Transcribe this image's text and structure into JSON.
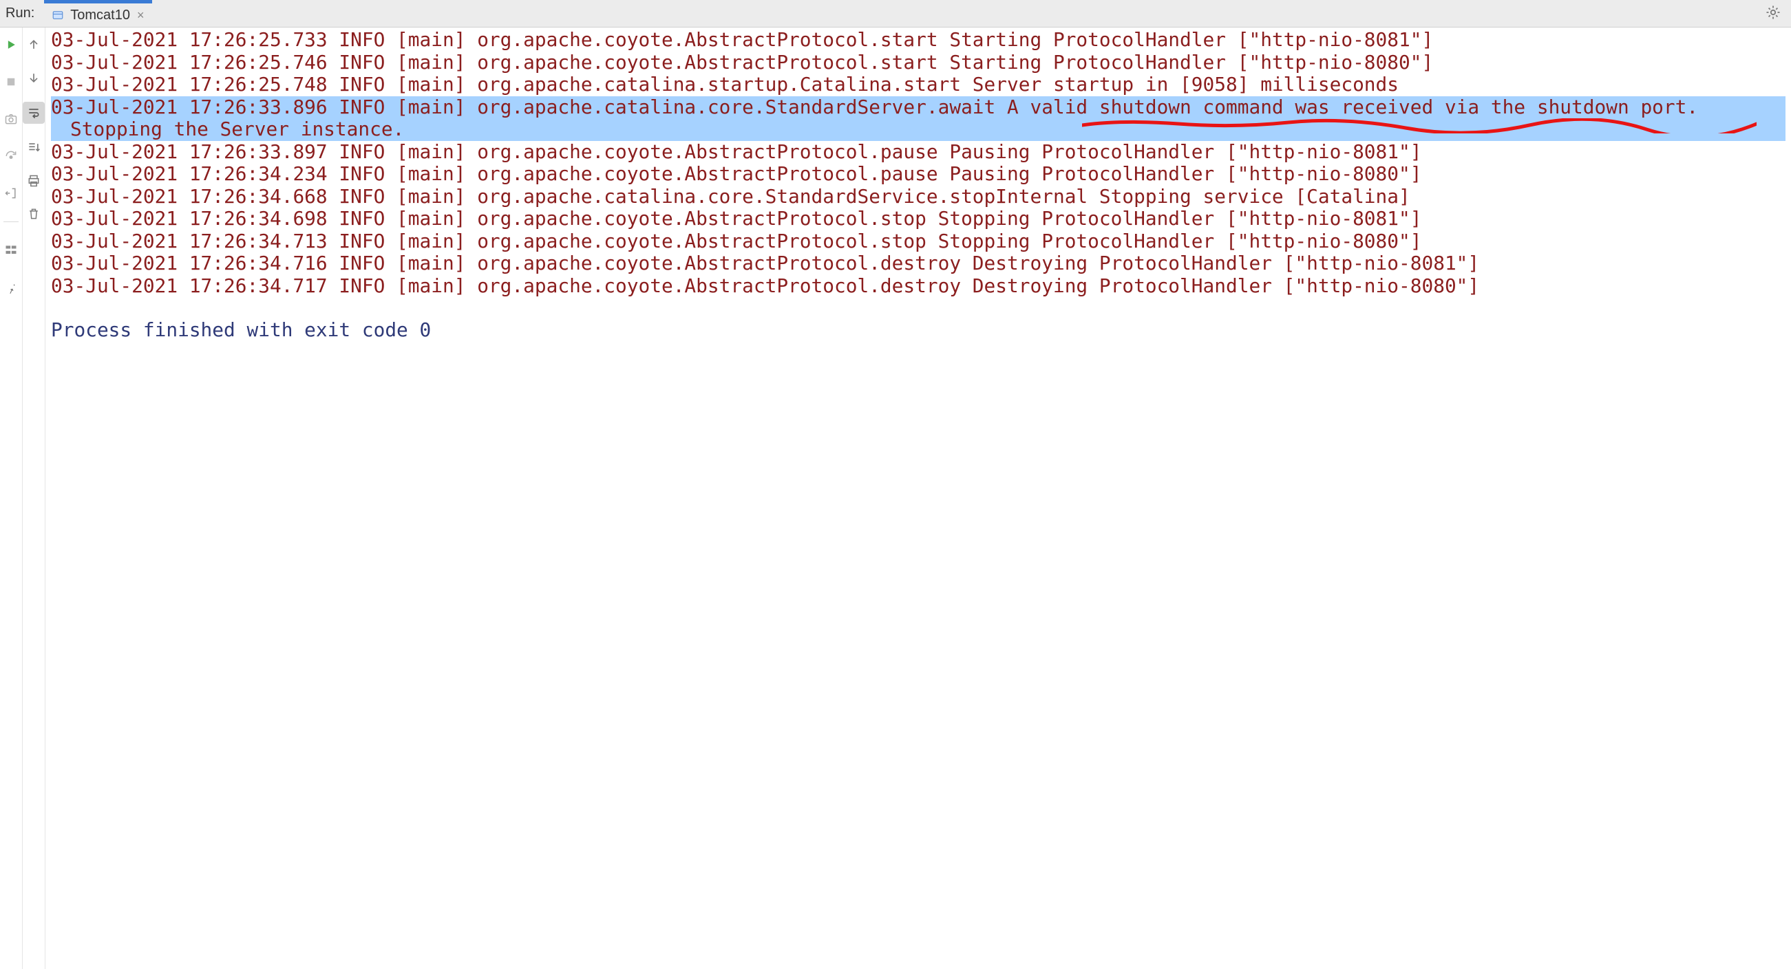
{
  "header": {
    "run_label": "Run:",
    "tab": {
      "label": "Tomcat10"
    }
  },
  "log": {
    "lines": [
      {
        "text": "03-Jul-2021 17:26:25.733 INFO [main] org.apache.coyote.AbstractProtocol.start Starting ProtocolHandler [\"http-nio-8081\"]",
        "kind": "err"
      },
      {
        "text": "03-Jul-2021 17:26:25.746 INFO [main] org.apache.coyote.AbstractProtocol.start Starting ProtocolHandler [\"http-nio-8080\"]",
        "kind": "err"
      },
      {
        "text": "03-Jul-2021 17:26:25.748 INFO [main] org.apache.catalina.startup.Catalina.start Server startup in [9058] milliseconds",
        "kind": "err"
      },
      {
        "text": "03-Jul-2021 17:26:33.896 INFO [main] org.apache.catalina.core.StandardServer.await A valid shutdown command was received via the shutdown port. Stopping the Server instance.",
        "kind": "highlight"
      },
      {
        "text": "03-Jul-2021 17:26:33.897 INFO [main] org.apache.coyote.AbstractProtocol.pause Pausing ProtocolHandler [\"http-nio-8081\"]",
        "kind": "err"
      },
      {
        "text": "03-Jul-2021 17:26:34.234 INFO [main] org.apache.coyote.AbstractProtocol.pause Pausing ProtocolHandler [\"http-nio-8080\"]",
        "kind": "err"
      },
      {
        "text": "03-Jul-2021 17:26:34.668 INFO [main] org.apache.catalina.core.StandardService.stopInternal Stopping service [Catalina]",
        "kind": "err"
      },
      {
        "text": "03-Jul-2021 17:26:34.698 INFO [main] org.apache.coyote.AbstractProtocol.stop Stopping ProtocolHandler [\"http-nio-8081\"]",
        "kind": "err"
      },
      {
        "text": "03-Jul-2021 17:26:34.713 INFO [main] org.apache.coyote.AbstractProtocol.stop Stopping ProtocolHandler [\"http-nio-8080\"]",
        "kind": "err"
      },
      {
        "text": "03-Jul-2021 17:26:34.716 INFO [main] org.apache.coyote.AbstractProtocol.destroy Destroying ProtocolHandler [\"http-nio-8081\"]",
        "kind": "err"
      },
      {
        "text": "03-Jul-2021 17:26:34.717 INFO [main] org.apache.coyote.AbstractProtocol.destroy Destroying ProtocolHandler [\"http-nio-8080\"]",
        "kind": "err"
      },
      {
        "text": "",
        "kind": "blank"
      },
      {
        "text": "Process finished with exit code 0",
        "kind": "exit"
      }
    ]
  },
  "annotation": {
    "color": "#e81414"
  }
}
